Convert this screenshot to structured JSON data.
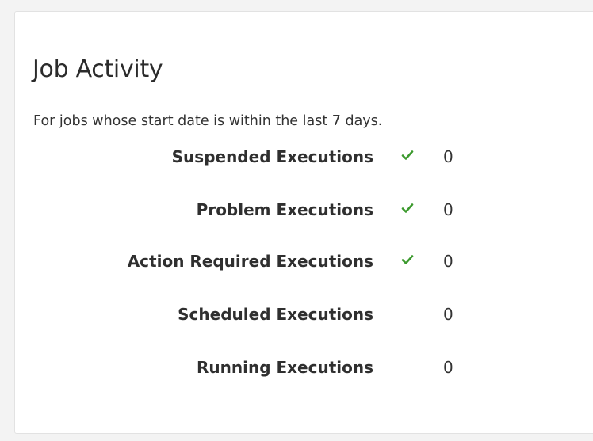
{
  "panel": {
    "title": "Job Activity",
    "subtitle": "For jobs whose start date is within the last 7 days."
  },
  "rows": [
    {
      "label": "Suspended Executions",
      "value": "0",
      "check": true
    },
    {
      "label": "Problem Executions",
      "value": "0",
      "check": true
    },
    {
      "label": "Action Required Executions",
      "value": "0",
      "check": true
    },
    {
      "label": "Scheduled Executions",
      "value": "0",
      "check": false
    },
    {
      "label": "Running Executions",
      "value": "0",
      "check": false
    }
  ],
  "colors": {
    "check": "#3c9a2e"
  },
  "icons": {
    "check": "check-icon"
  }
}
